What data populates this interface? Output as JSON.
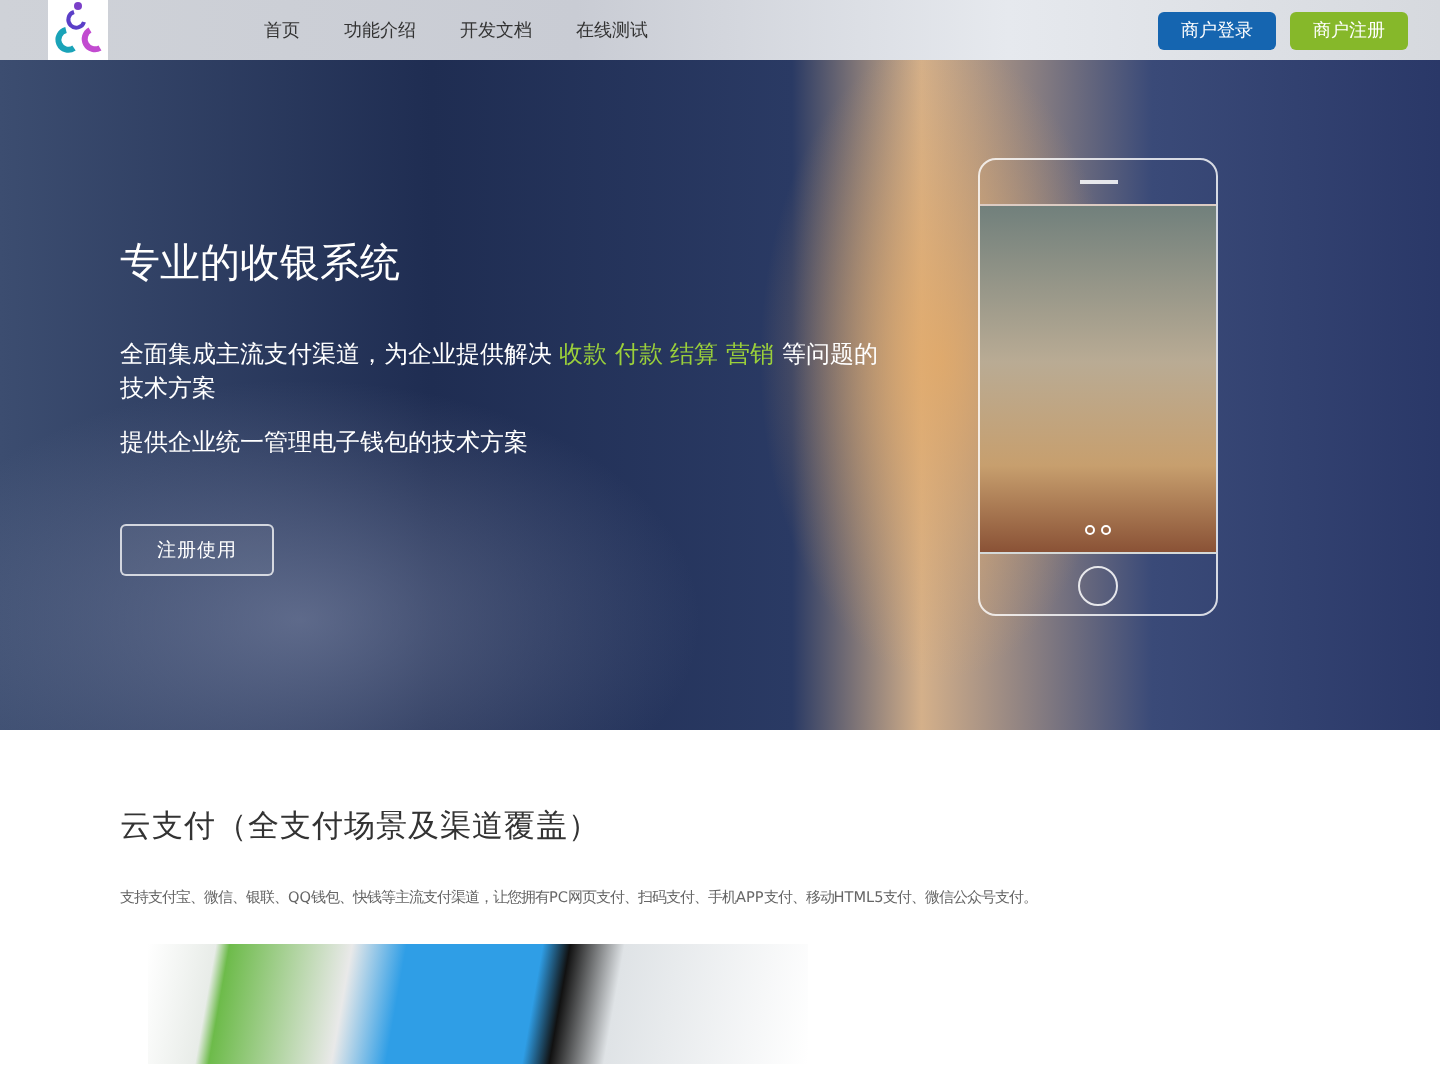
{
  "nav": {
    "links": [
      {
        "label": "首页"
      },
      {
        "label": "功能介绍"
      },
      {
        "label": "开发文档"
      },
      {
        "label": "在线测试"
      }
    ],
    "buttons": [
      {
        "label": "商户登录",
        "kind": "login"
      },
      {
        "label": "商户注册",
        "kind": "register"
      }
    ]
  },
  "hero": {
    "title": "专业的收银系统",
    "intro": [
      {
        "text": "全面集成主流支付渠道，为企业提供解决",
        "highlight": false
      },
      {
        "text": " 收款 付款 结算 营销 ",
        "highlight": true
      },
      {
        "text": "等问题的技术方案",
        "highlight": false
      }
    ],
    "subtitle": "提供企业统一管理电子钱包的技术方案",
    "cta": "注册使用"
  },
  "section": {
    "title": "云支付（全支付场景及渠道覆盖）",
    "description": "支持支付宝、微信、银联、QQ钱包、快钱等主流支付渠道，让您拥有PC网页支付、扫码支付、手机APP支付、移动HTML5支付、微信公众号支付。"
  }
}
